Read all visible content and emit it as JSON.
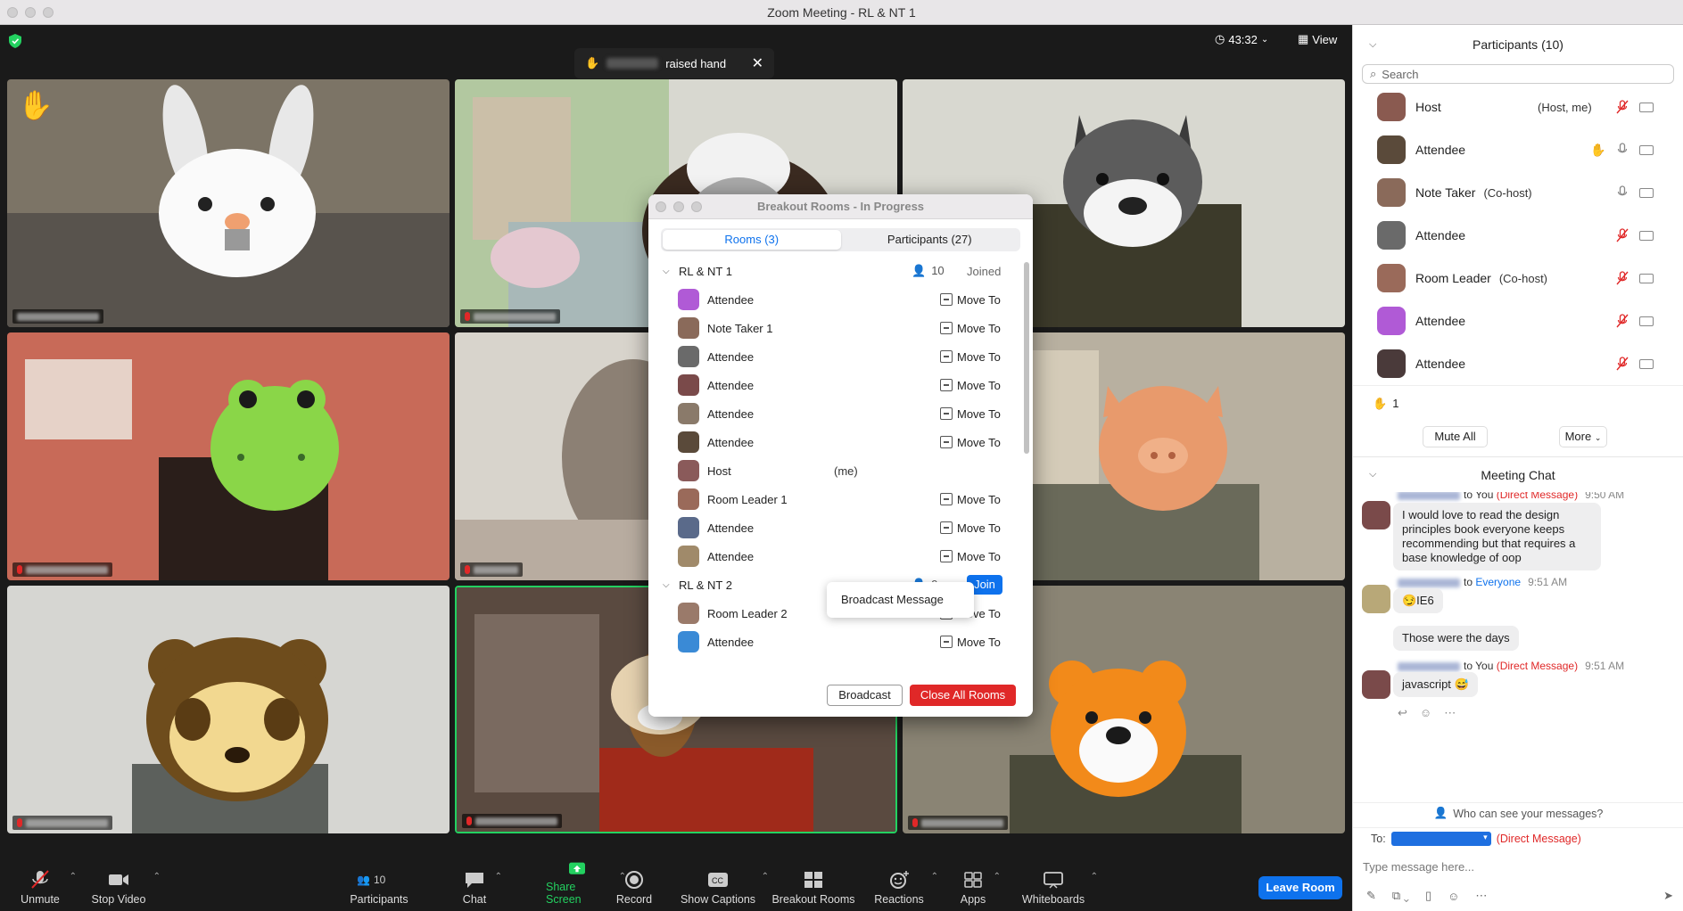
{
  "window": {
    "title": "Zoom Meeting - RL & NT 1"
  },
  "topbar": {
    "timer": "43:32",
    "view_label": "View"
  },
  "toast": {
    "suffix": "raised hand"
  },
  "breakout": {
    "title": "Breakout Rooms - In Progress",
    "tabs": [
      {
        "label": "Rooms (3)"
      },
      {
        "label": "Participants (27)"
      }
    ],
    "rooms": [
      {
        "name": "RL & NT 1",
        "count": "10",
        "state": "Joined",
        "members": [
          {
            "name": "Attendee",
            "action": "Move To",
            "color": "#b05ad6"
          },
          {
            "name": "Note Taker 1",
            "action": "Move To",
            "color": "#8a6a5a"
          },
          {
            "name": "Attendee",
            "action": "Move To",
            "color": "#6a6a6a"
          },
          {
            "name": "Attendee",
            "action": "Move To",
            "color": "#7a4a4a"
          },
          {
            "name": "Attendee",
            "action": "Move To",
            "color": "#8a7a6a"
          },
          {
            "name": "Attendee",
            "action": "Move To",
            "color": "#5a4a3a"
          },
          {
            "name": "Host",
            "me": "(me)",
            "color": "#8a5a5a"
          },
          {
            "name": "Room Leader 1",
            "action": "Move To",
            "color": "#9a6a5a"
          },
          {
            "name": "Attendee",
            "action": "Move To",
            "color": "#5a6a8a"
          },
          {
            "name": "Attendee",
            "action": "Move To",
            "color": "#a08a6a"
          }
        ]
      },
      {
        "name": "RL & NT 2",
        "count": "9",
        "join_label": "Join",
        "members": [
          {
            "name": "Room Leader 2",
            "action": "Move To",
            "color": "#9a7a6a"
          },
          {
            "name": "Attendee",
            "action": "Move To",
            "color": "#3a8ad6"
          }
        ]
      }
    ],
    "popup_label": "Broadcast Message",
    "broadcast_label": "Broadcast",
    "close_all_label": "Close All Rooms"
  },
  "toolbar": {
    "unmute": "Unmute",
    "stop_video": "Stop Video",
    "participants": "Participants",
    "participants_count": "10",
    "chat": "Chat",
    "share": "Share Screen",
    "record": "Record",
    "captions": "Show Captions",
    "breakout": "Breakout Rooms",
    "reactions": "Reactions",
    "apps": "Apps",
    "whiteboards": "Whiteboards",
    "leave": "Leave Room"
  },
  "participants_panel": {
    "title": "Participants (10)",
    "search_placeholder": "Search",
    "rows": [
      {
        "name": "Host",
        "role": "(Host, me)",
        "mic": "muted",
        "color": "#8a5a50"
      },
      {
        "name": "Attendee",
        "role": "",
        "hand": true,
        "mic": "on",
        "color": "#5a4a3a"
      },
      {
        "name": "Note Taker",
        "role": "(Co-host)",
        "mic": "on",
        "color": "#8a6a5a"
      },
      {
        "name": "Attendee",
        "role": "",
        "mic": "muted",
        "color": "#6a6a6a"
      },
      {
        "name": "Room Leader",
        "role": "(Co-host)",
        "mic": "muted",
        "color": "#9a6a5a"
      },
      {
        "name": "Attendee",
        "role": "",
        "mic": "muted",
        "color": "#b05ad6"
      },
      {
        "name": "Attendee",
        "role": "",
        "mic": "muted",
        "color": "#4a3a3a"
      }
    ],
    "hand_count": "1",
    "mute_all": "Mute All",
    "more": "More"
  },
  "chat": {
    "title": "Meeting Chat",
    "messages": [
      {
        "to": "to You",
        "dm": "(Direct Message)",
        "time": "9:50 AM",
        "text": "I would love to read the design principles book everyone keeps recommending but that requires a base knowledge of oop"
      },
      {
        "to": "to",
        "everyone": "Everyone",
        "time": "9:51 AM",
        "text": "😏IE6",
        "text2": "Those were the days"
      },
      {
        "to": "to You",
        "dm": "(Direct Message)",
        "time": "9:51 AM",
        "text": "javascript 😅"
      }
    ],
    "who_can_see": "Who can see your messages?",
    "to_label": "To:",
    "to_dm": "(Direct Message)",
    "placeholder": "Type message here..."
  },
  "colors": {
    "accent": "#0e72ed",
    "danger": "#e02828",
    "active_speaker": "#23d160"
  }
}
